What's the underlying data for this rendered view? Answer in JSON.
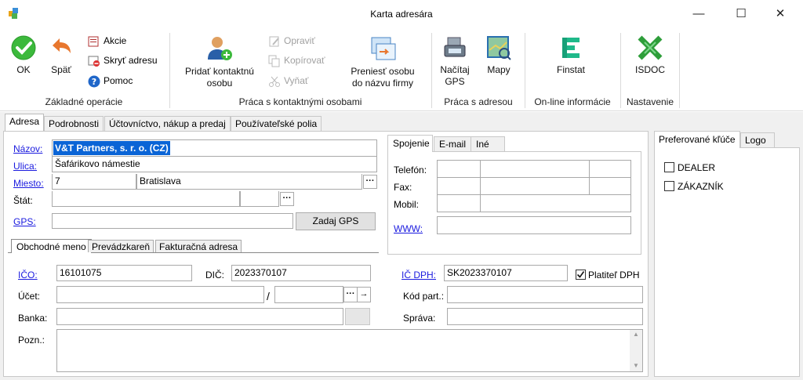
{
  "window": {
    "title": "Karta adresára",
    "minimize_glyph": "—",
    "maximize_glyph": "☐",
    "close_glyph": "✕"
  },
  "ribbon": {
    "ok": "OK",
    "back": "Späť",
    "actions": "Akcie",
    "hide_address": "Skryť adresu",
    "help": "Pomoc",
    "add_contact_line1": "Pridať kontaktnú",
    "add_contact_line2": "osobu",
    "edit": "Opraviť",
    "copy": "Kopírovať",
    "cut": "Vyňať",
    "transfer_line1": "Preniesť osobu",
    "transfer_line2": "do názvu firmy",
    "load_gps_line1": "Načítaj",
    "load_gps_line2": "GPS",
    "maps": "Mapy",
    "finstat": "Finstat",
    "isdoc": "ISDOC",
    "group_basic": "Základné operácie",
    "group_contacts": "Práca s kontaktnými osobami",
    "group_address": "Práca s adresou",
    "group_online": "On-line informácie",
    "group_settings": "Nastavenie"
  },
  "tabs": {
    "address": "Adresa",
    "details": "Podrobnosti",
    "accounting": "Účtovníctvo, nákup a predaj",
    "user_fields": "Používateľské polia"
  },
  "address": {
    "name_label": "Názov:",
    "name_value": "V&T Partners, s. r. o. (CZ)",
    "street_label": "Ulica:",
    "street_value": "Šafárikovo námestie",
    "city_label": "Miesto:",
    "zip_value": "7",
    "city_value": "Bratislava",
    "state_label": "Štát:",
    "state_value": "",
    "gps_label": "GPS:",
    "gps_value": "",
    "gps_button": "Zadaj GPS"
  },
  "contact": {
    "tab_connection": "Spojenie",
    "tab_email": "E-mail",
    "tab_other": "Iné",
    "phone_label": "Telefón:",
    "fax_label": "Fax:",
    "mobile_label": "Mobil:",
    "www_label": "WWW:",
    "www_value": ""
  },
  "subtabs": {
    "business_name": "Obchodné meno",
    "premises": "Prevádzkareň",
    "billing_address": "Fakturačná adresa"
  },
  "business": {
    "ico_label": "IČO:",
    "ico_value": "16101075",
    "dic_label": "DIČ:",
    "dic_value": "2023370107",
    "icdph_label": "IČ DPH:",
    "icdph_value": "SK2023370107",
    "vat_payer_label": "Platiteľ DPH",
    "vat_payer_checked": true,
    "account_label": "Účet:",
    "account_value": "",
    "bank_code_value": "",
    "partner_code_label": "Kód part.:",
    "partner_code_value": "",
    "bank_label": "Banka:",
    "bank_value": "",
    "message_label": "Správa:",
    "message_value": "",
    "note_label": "Pozn.:",
    "note_value": ""
  },
  "right_panel": {
    "tab_keys": "Preferované kľúče",
    "tab_logo": "Logo",
    "keys": [
      {
        "label": "DEALER",
        "checked": false
      },
      {
        "label": "ZÁKAZNÍK",
        "checked": false
      }
    ]
  },
  "colors": {
    "link": "#1a1adf",
    "selection": "#0a64d6",
    "ok_green": "#3cb93c",
    "help_blue": "#1f66c9",
    "finstat": "#1fb98a",
    "isdoc": "#2e9e3a"
  }
}
